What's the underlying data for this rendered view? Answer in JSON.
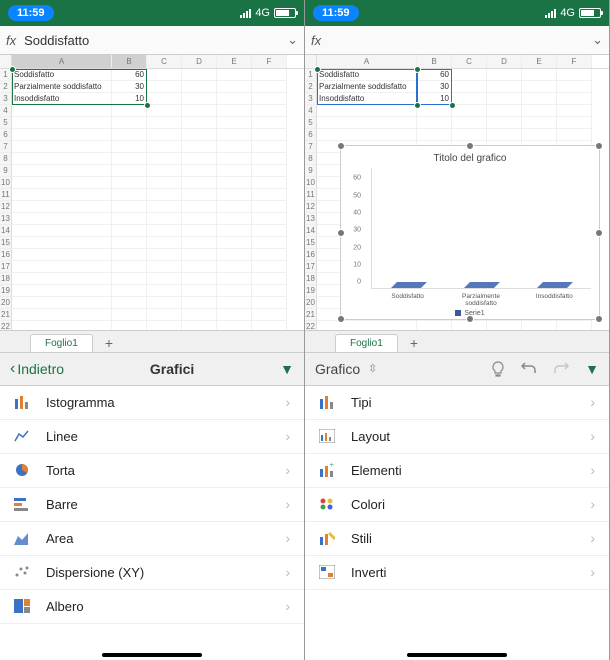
{
  "status": {
    "time": "11:59",
    "network": "4G"
  },
  "formula_left": {
    "fx": "fx",
    "value": "Soddisfatto"
  },
  "formula_right": {
    "fx": "fx",
    "value": ""
  },
  "columns": [
    "A",
    "B",
    "C",
    "D",
    "E",
    "F"
  ],
  "cells": {
    "r1a": "Soddisfatto",
    "r1b": "60",
    "r2a": "Parzialmente soddisfatto",
    "r2b": "30",
    "r3a": "Insoddisfatto",
    "r3b": "10"
  },
  "sheet_tab": "Foglio1",
  "left_toolbar": {
    "back": "Indietro",
    "title": "Grafici"
  },
  "left_options": {
    "histogram": "Istogramma",
    "lines": "Linee",
    "pie": "Torta",
    "bars": "Barre",
    "area": "Area",
    "scatter": "Dispersione (XY)",
    "tree": "Albero"
  },
  "right_toolbar": {
    "title": "Grafico"
  },
  "right_options": {
    "types": "Tipi",
    "layout": "Layout",
    "elements": "Elementi",
    "colors": "Colori",
    "styles": "Stili",
    "invert": "Inverti"
  },
  "chart": {
    "title": "Titolo del grafico",
    "legend": "Serie1",
    "x": {
      "c1": "Soddisfatto",
      "c2": "Parzialmente soddisfatto",
      "c3": "Insoddisfatto"
    },
    "y": {
      "t0": "0",
      "t10": "10",
      "t20": "20",
      "t30": "30",
      "t40": "40",
      "t50": "50",
      "t60": "60"
    }
  },
  "chart_data": {
    "type": "bar",
    "categories": [
      "Soddisfatto",
      "Parzialmente soddisfatto",
      "Insoddisfatto"
    ],
    "series": [
      {
        "name": "Serie1",
        "values": [
          60,
          30,
          10
        ]
      }
    ],
    "title": "Titolo del grafico",
    "xlabel": "",
    "ylabel": "",
    "ylim": [
      0,
      70
    ]
  }
}
